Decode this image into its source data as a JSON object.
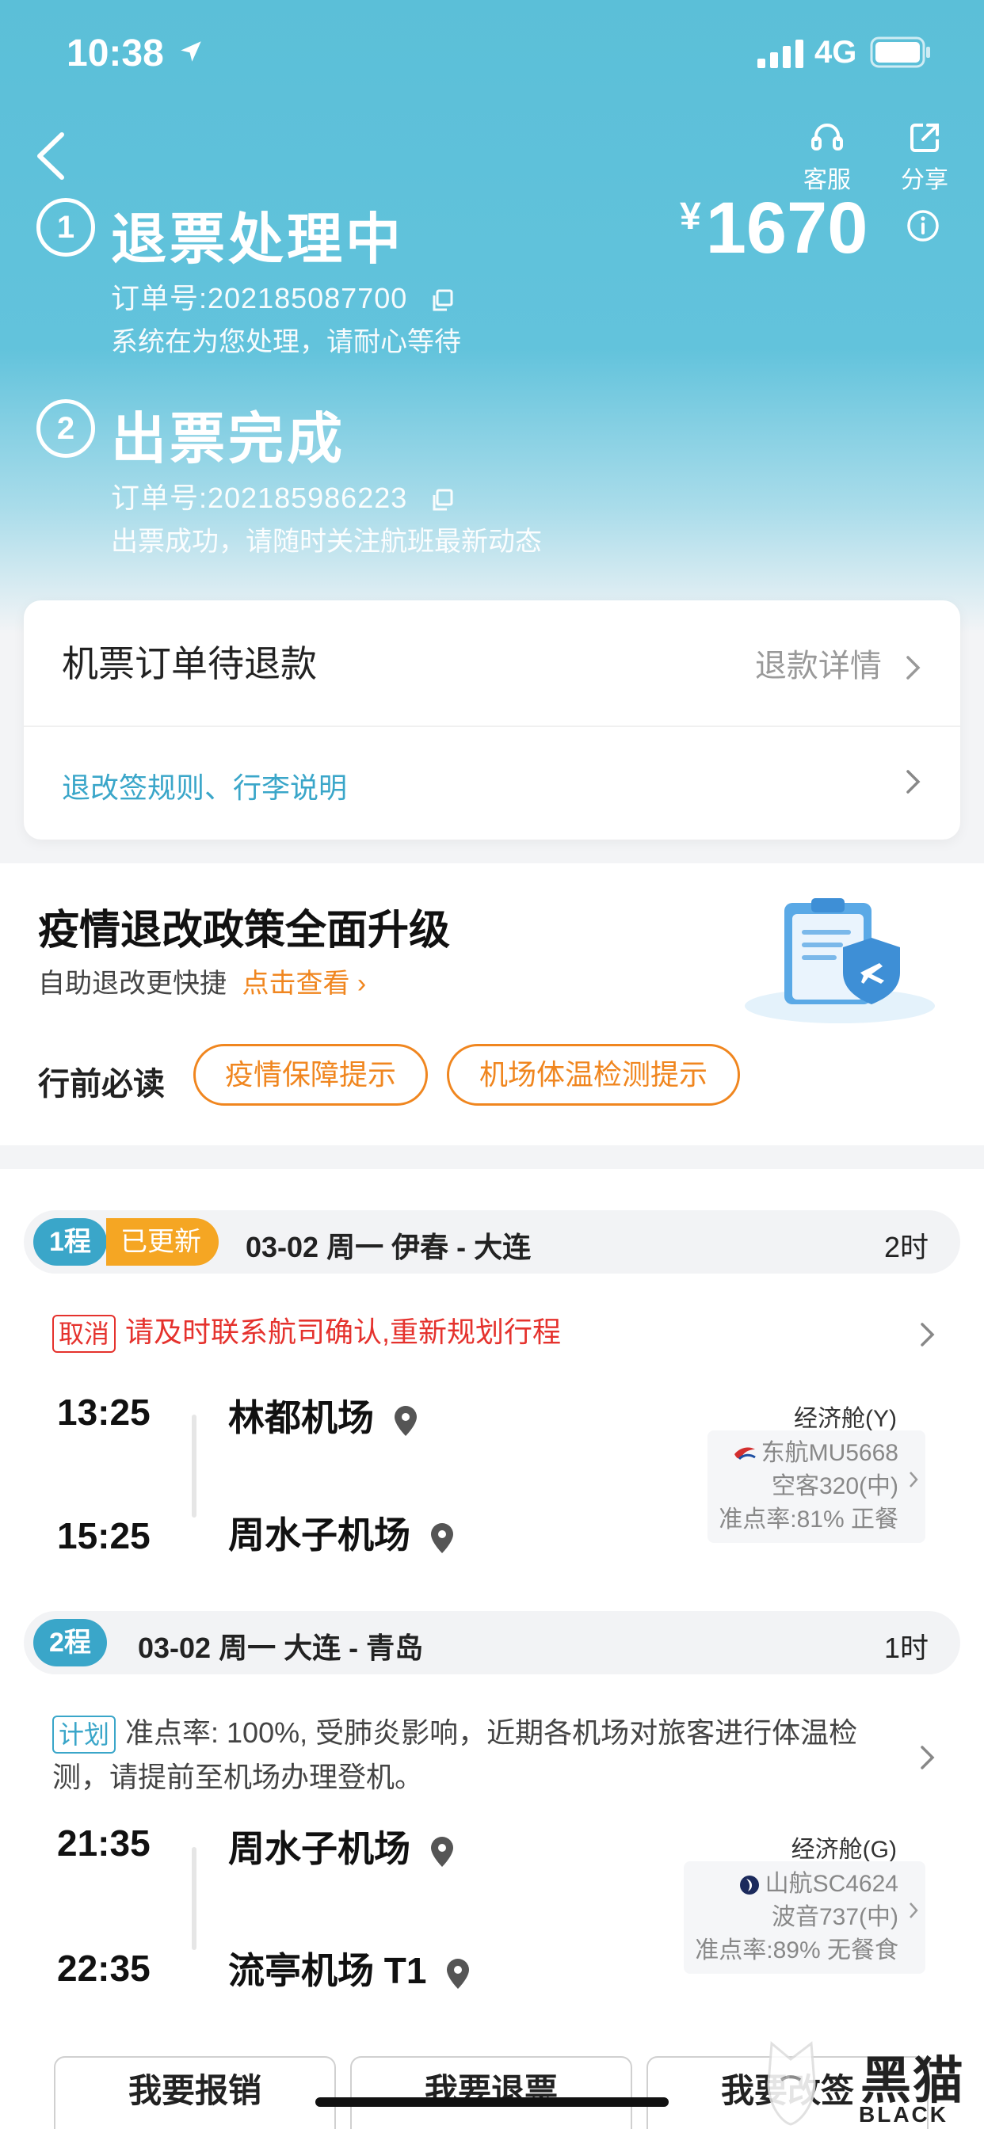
{
  "status_bar": {
    "time": "10:38",
    "network": "4G"
  },
  "header": {
    "service_label": "客服",
    "share_label": "分享",
    "price_currency": "¥",
    "price": "1670"
  },
  "steps": [
    {
      "number": "1",
      "title": "退票处理中",
      "order_label": "订单号:202185087700",
      "desc": "系统在为您处理，请耐心等待"
    },
    {
      "number": "2",
      "title": "出票完成",
      "order_label": "订单号:202185986223",
      "desc": "出票成功，请随时关注航班最新动态"
    }
  ],
  "refund_card": {
    "title": "机票订单待退款",
    "detail_link": "退款详情",
    "rules_link": "退改签规则、行李说明"
  },
  "policy": {
    "title": "疫情退改政策全面升级",
    "subtitle": "自助退改更快捷",
    "subtitle_link": "点击查看",
    "pre_read_label": "行前必读",
    "tags": [
      "疫情保障提示",
      "机场体温检测提示"
    ]
  },
  "segments": [
    {
      "badge": "1程",
      "updated_badge": "已更新",
      "route": "03-02  周一  伊春 - 大连",
      "duration": "2时",
      "notice_tag": "取消",
      "notice_text": "请及时联系航司确认,重新规划行程",
      "depart_time": "13:25",
      "depart_airport": "林都机场",
      "arrive_time": "15:25",
      "arrive_airport": "周水子机场",
      "cabin": "经济舱(Y)",
      "flight": "东航MU5668",
      "aircraft": "空客320(中)",
      "ontime": "准点率:81% 正餐"
    },
    {
      "badge": "2程",
      "route": "03-02  周一  大连 - 青岛",
      "duration": "1时",
      "notice_tag": "计划",
      "notice_text": "准点率: 100%, 受肺炎影响，近期各机场对旅客进行体温检测，请提前至机场办理登机。",
      "depart_time": "21:35",
      "depart_airport": "周水子机场",
      "arrive_time": "22:35",
      "arrive_airport": "流亭机场 T1",
      "cabin": "经济舱(G)",
      "flight": "山航SC4624",
      "aircraft": "波音737(中)",
      "ontime": "准点率:89% 无餐食"
    }
  ],
  "actions": [
    "我要报销",
    "我要退票",
    "我要改签"
  ],
  "watermark": {
    "text": "黑猫",
    "sub": "BLACK CAT"
  },
  "colors": {
    "header": "#5bbfd8",
    "accent_blue": "#3aa6c9",
    "accent_orange": "#f0861f",
    "cancel_red": "#e5322d",
    "updated_orange": "#f5a623"
  }
}
